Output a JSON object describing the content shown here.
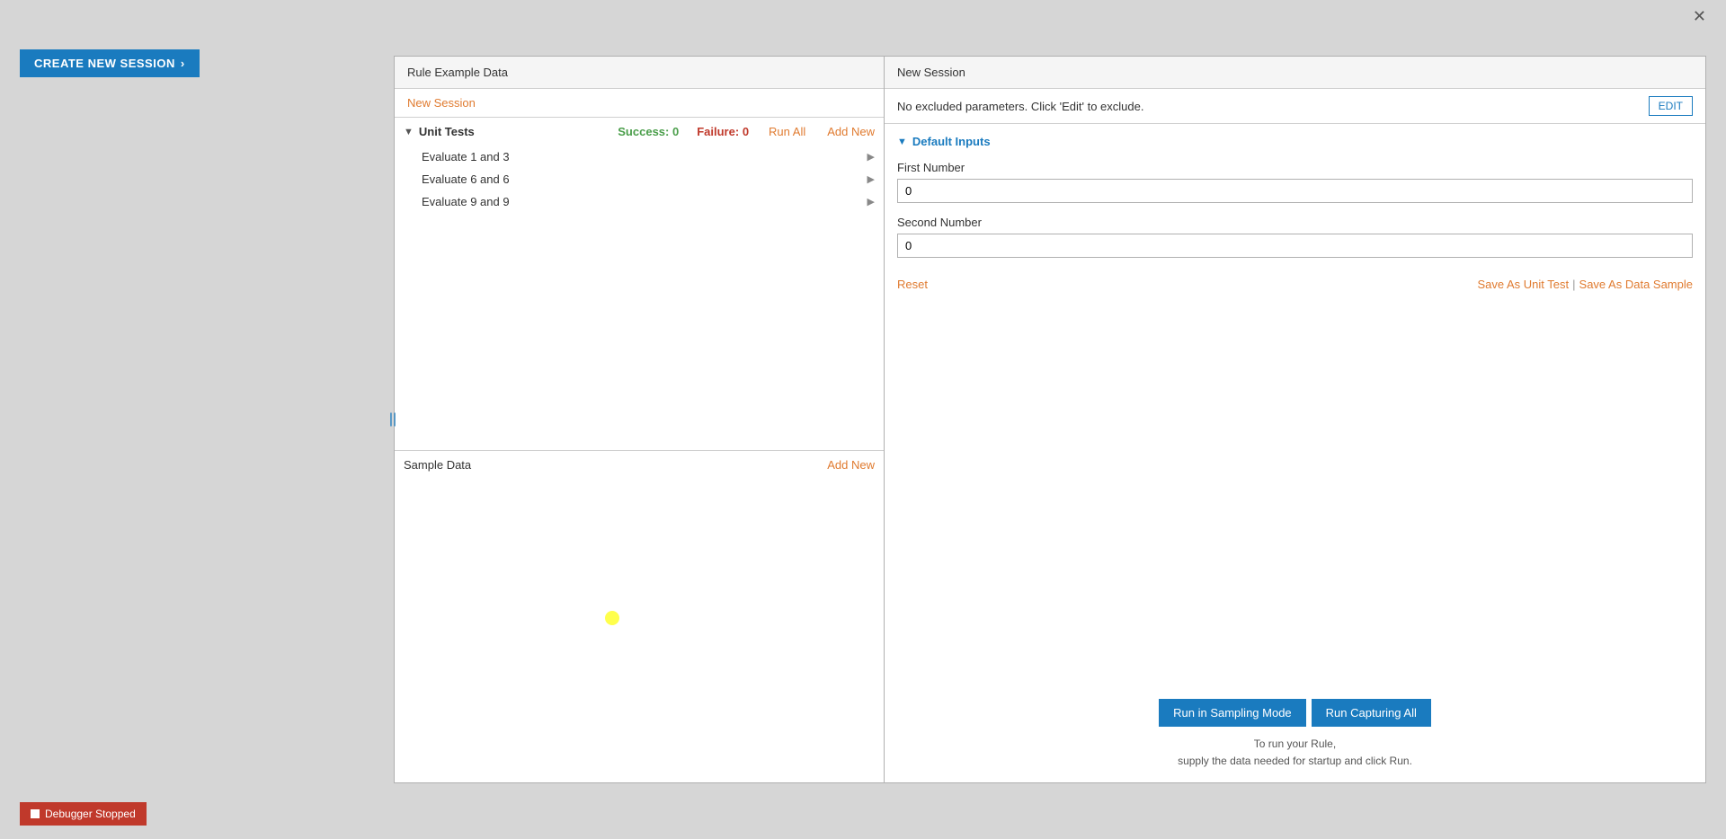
{
  "createSession": {
    "label": "CREATE NEW SESSION",
    "arrowIcon": "›"
  },
  "closeIcon": "✕",
  "leftPanel": {
    "header": "Rule Example Data",
    "newSessionTab": "New Session",
    "unitTests": {
      "title": "Unit Tests",
      "successLabel": "Success:",
      "successCount": "0",
      "failureLabel": "Failure:",
      "failureCount": "0",
      "runAllLabel": "Run All",
      "addNewLabel": "Add New",
      "tests": [
        {
          "name": "Evaluate 1 and 3"
        },
        {
          "name": "Evaluate 6 and 6"
        },
        {
          "name": "Evaluate 9 and 9"
        }
      ]
    },
    "sampleData": {
      "title": "Sample Data",
      "addNewLabel": "Add New"
    }
  },
  "rightPanel": {
    "header": "New Session",
    "noExcludedText": "No excluded parameters. Click 'Edit' to exclude.",
    "editLabel": "EDIT",
    "defaultInputs": {
      "title": "Default Inputs",
      "fields": [
        {
          "label": "First Number",
          "value": "0",
          "name": "first-number-input"
        },
        {
          "label": "Second Number",
          "value": "0",
          "name": "second-number-input"
        }
      ]
    },
    "resetLabel": "Reset",
    "saveAsUnitTestLabel": "Save As Unit Test",
    "saveAsDataSampleLabel": "Save As Data Sample",
    "runSamplingLabel": "Run in Sampling Mode",
    "runCapturingLabel": "Run Capturing All",
    "runHintLine1": "To run your Rule,",
    "runHintLine2": "supply the data needed for startup and click Run."
  },
  "debugger": {
    "label": "Debugger Stopped",
    "dotColor": "#fff"
  },
  "dividerIcon": "||"
}
